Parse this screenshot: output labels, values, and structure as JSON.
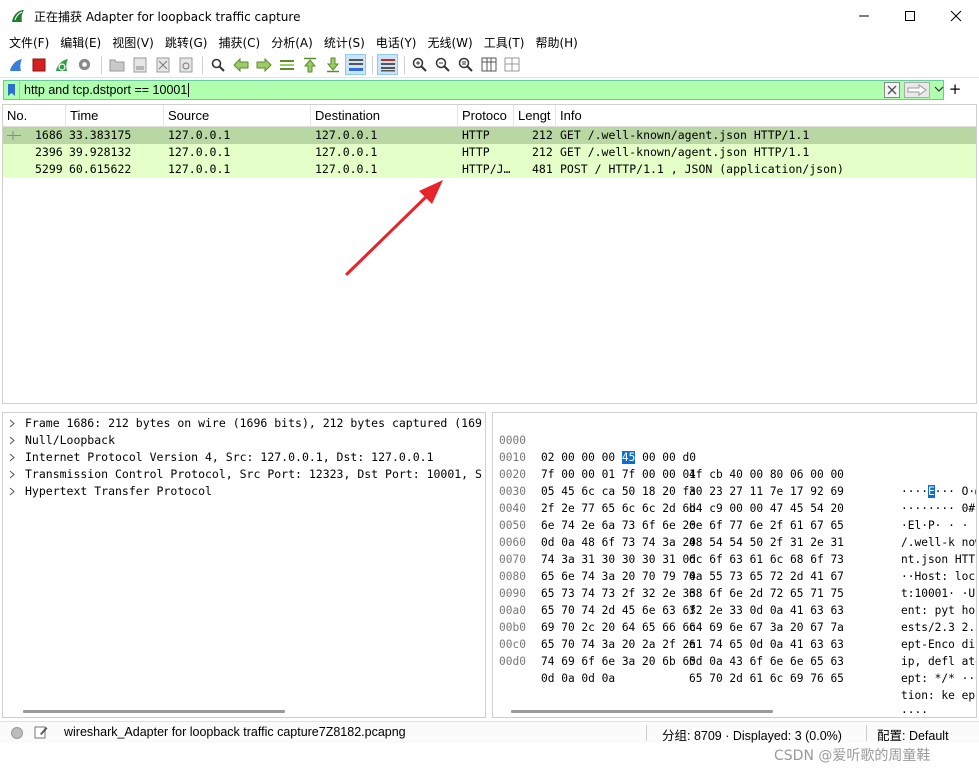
{
  "window": {
    "title": "正在捕获 Adapter for loopback traffic capture"
  },
  "menu": [
    "文件(F)",
    "编辑(E)",
    "视图(V)",
    "跳转(G)",
    "捕获(C)",
    "分析(A)",
    "统计(S)",
    "电话(Y)",
    "无线(W)",
    "工具(T)",
    "帮助(H)"
  ],
  "filter": {
    "value": "http and tcp.dstport == 10001"
  },
  "columns": [
    "No.",
    "Time",
    "Source",
    "Destination",
    "Protoco",
    "Lengt",
    "Info"
  ],
  "packets": [
    {
      "no": "1686",
      "time": "33.383175",
      "source": "127.0.0.1",
      "destination": "127.0.0.1",
      "protocol": "HTTP",
      "length": "212",
      "info": "GET /.well-known/agent.json HTTP/1.1"
    },
    {
      "no": "2396",
      "time": "39.928132",
      "source": "127.0.0.1",
      "destination": "127.0.0.1",
      "protocol": "HTTP",
      "length": "212",
      "info": "GET /.well-known/agent.json HTTP/1.1"
    },
    {
      "no": "5299",
      "time": "60.615622",
      "source": "127.0.0.1",
      "destination": "127.0.0.1",
      "protocol": "HTTP/J…",
      "length": "481",
      "info": "POST / HTTP/1.1 , JSON (application/json)"
    }
  ],
  "details": [
    "Frame 1686: 212 bytes on wire (1696 bits), 212 bytes captured (169",
    "Null/Loopback",
    "Internet Protocol Version 4, Src: 127.0.0.1, Dst: 127.0.0.1",
    "Transmission Control Protocol, Src Port: 12323, Dst Port: 10001, S",
    "Hypertext Transfer Protocol"
  ],
  "hex": [
    {
      "off": "0000",
      "b1": "02 00 00 00",
      "b1h": "45",
      "b1t": "00 00 d0",
      "b2": "4f cb 40 00 80 06 00 00",
      "a1": "····",
      "ah": "E",
      "a2": "··· O·@"
    },
    {
      "off": "0010",
      "b1": "7f 00 00 01 7f 00 00 01",
      "b2": "30 23 27 11 7e 17 92 69",
      "a1": "········ 0#",
      "ah": "",
      "a2": ""
    },
    {
      "off": "0020",
      "b1": "05 45 6c ca 50 18 20 fa",
      "b2": "d4 c9 00 00 47 45 54 20",
      "a1": "·El·P· · ·",
      "ah": "",
      "a2": ""
    },
    {
      "off": "0030",
      "b1": "2f 2e 77 65 6c 6c 2d 6b",
      "b2": "6e 6f 77 6e 2f 61 67 65",
      "a1": "/.well-k now",
      "ah": "",
      "a2": ""
    },
    {
      "off": "0040",
      "b1": "6e 74 2e 6a 73 6f 6e 20",
      "b2": "48 54 54 50 2f 31 2e 31",
      "a1": "nt.json HTT",
      "ah": "",
      "a2": ""
    },
    {
      "off": "0050",
      "b1": "0d 0a 48 6f 73 74 3a 20",
      "b2": "6c 6f 63 61 6c 68 6f 73",
      "a1": "··Host: loc",
      "ah": "",
      "a2": ""
    },
    {
      "off": "0060",
      "b1": "74 3a 31 30 30 30 31 0d",
      "b2": "0a 55 73 65 72 2d 41 67",
      "a1": "t:10001· ·Us",
      "ah": "",
      "a2": ""
    },
    {
      "off": "0070",
      "b1": "65 6e 74 3a 20 70 79 74",
      "b2": "68 6f 6e 2d 72 65 71 75",
      "a1": "ent: pyt hon",
      "ah": "",
      "a2": ""
    },
    {
      "off": "0080",
      "b1": "65 73 74 73 2f 32 2e 33",
      "b2": "32 2e 33 0d 0a 41 63 63",
      "a1": "ests/2.3 2.3",
      "ah": "",
      "a2": ""
    },
    {
      "off": "0090",
      "b1": "65 70 74 2d 45 6e 63 6f",
      "b2": "64 69 6e 67 3a 20 67 7a",
      "a1": "ept-Enco din",
      "ah": "",
      "a2": ""
    },
    {
      "off": "00a0",
      "b1": "69 70 2c 20 64 65 66 6c",
      "b2": "61 74 65 0d 0a 41 63 63",
      "a1": "ip, defl ate",
      "ah": "",
      "a2": ""
    },
    {
      "off": "00b0",
      "b1": "65 70 74 3a 20 2a 2f 2a",
      "b2": "0d 0a 43 6f 6e 6e 65 63",
      "a1": "ept: */* ··C",
      "ah": "",
      "a2": ""
    },
    {
      "off": "00c0",
      "b1": "74 69 6f 6e 3a 20 6b 65",
      "b2": "65 70 2d 61 6c 69 76 65",
      "a1": "tion: ke ep-",
      "ah": "",
      "a2": ""
    },
    {
      "off": "00d0",
      "b1": "0d 0a 0d 0a",
      "b2": "",
      "a1": "····",
      "ah": "",
      "a2": ""
    }
  ],
  "status": {
    "file": "wireshark_Adapter for loopback traffic capture7Z8182.pcapng",
    "packets": "分组: 8709 · Displayed: 3 (0.0%)",
    "profile": "配置: Default"
  },
  "watermark": "CSDN @爱听歌的周童鞋",
  "colors": {
    "filter_bg": "#afffaf",
    "row_selected": "#b8d7a3",
    "row_http": "#e4ffc7",
    "annotation_arrow": "#e8242b",
    "hex_highlight": "#0a6fd0"
  }
}
